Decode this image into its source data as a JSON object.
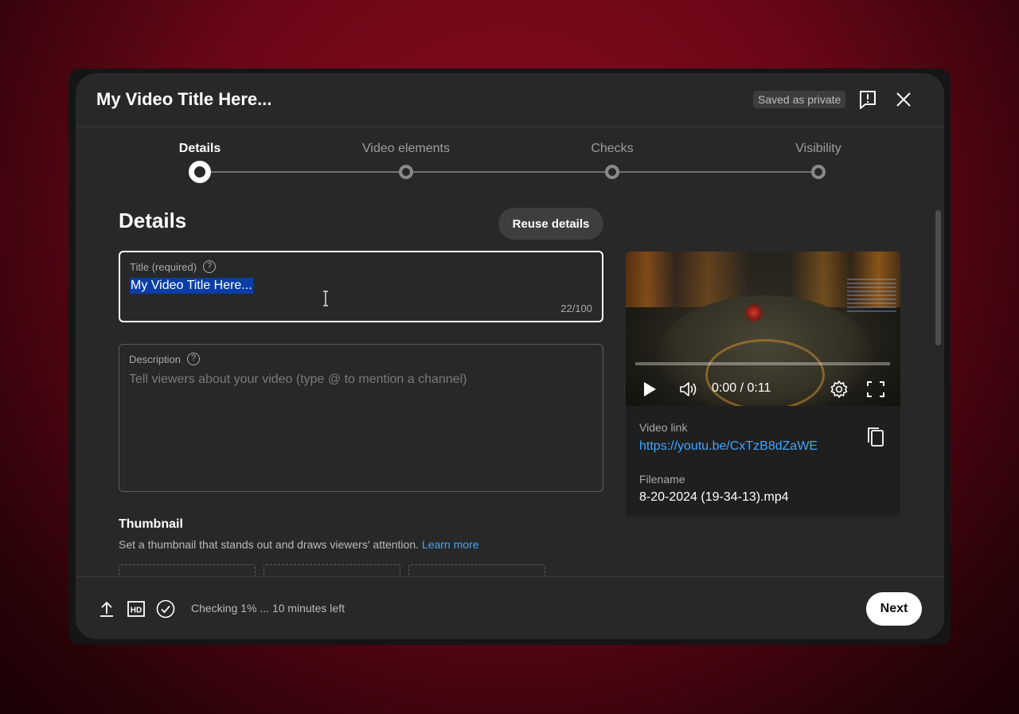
{
  "dialog": {
    "title": "My Video Title Here...",
    "saved_badge": "Saved as private"
  },
  "steps": [
    {
      "label": "Details",
      "active": true
    },
    {
      "label": "Video elements",
      "active": false
    },
    {
      "label": "Checks",
      "active": false
    },
    {
      "label": "Visibility",
      "active": false
    }
  ],
  "details": {
    "heading": "Details",
    "reuse_label": "Reuse details",
    "title_field": {
      "label": "Title (required)",
      "value": "My Video Title Here...",
      "counter": "22/100"
    },
    "description_field": {
      "label": "Description",
      "placeholder": "Tell viewers about your video (type @ to mention a channel)"
    },
    "thumbnail": {
      "heading": "Thumbnail",
      "text": "Set a thumbnail that stands out and draws viewers' attention.",
      "link": "Learn more"
    }
  },
  "preview": {
    "time": "0:00 / 0:11",
    "video_link_label": "Video link",
    "video_link": "https://youtu.be/CxTzB8dZaWE",
    "filename_label": "Filename",
    "filename": "8-20-2024 (19-34-13).mp4"
  },
  "footer": {
    "status": "Checking 1% ... 10 minutes left",
    "next_label": "Next"
  },
  "icons": [
    "upload-icon",
    "hd-icon",
    "check-circle-icon",
    "feedback-icon",
    "close-icon",
    "help-icon",
    "play-icon",
    "volume-icon",
    "settings-icon",
    "fullscreen-icon",
    "copy-icon"
  ],
  "colors": {
    "dialog_bg": "#282828",
    "link": "#3ea6ff",
    "selection": "#0a3ea6"
  }
}
